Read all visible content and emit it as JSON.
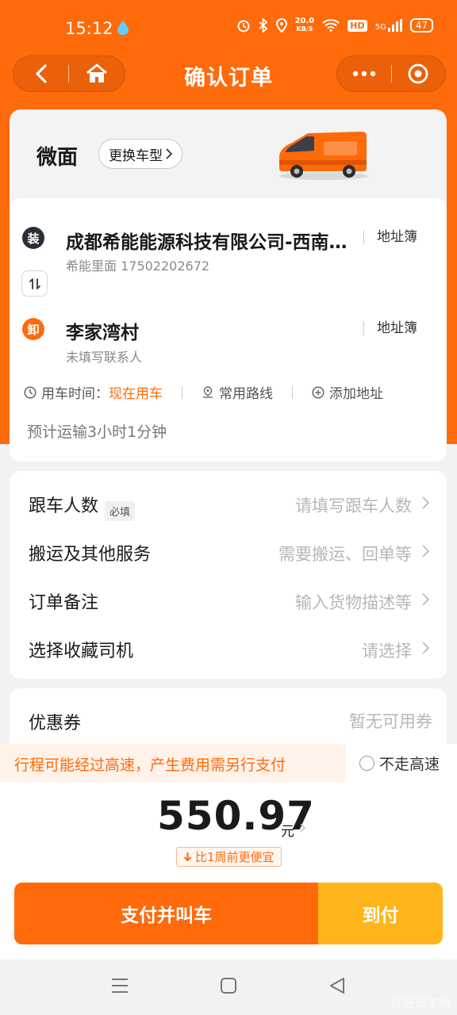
{
  "status_bar": {
    "time": "15:12",
    "speed_value": "20.0",
    "speed_unit": "KB/S",
    "hd": "HD",
    "signal": "5G",
    "battery": "47"
  },
  "nav": {
    "title": "确认订单"
  },
  "vehicle": {
    "name": "微面",
    "change_label": "更换车型"
  },
  "addresses": {
    "load_badge": "装",
    "unload_badge": "卸",
    "load_title": "成都希能能源科技有限公司-西南…",
    "load_contact": "希能里面 17502202672",
    "unload_title": "李家湾村",
    "unload_contact": "未填写联系人",
    "address_book_label": "地址簿",
    "time_prefix": "用车时间：",
    "time_value": "现在用车",
    "common_route": "常用路线",
    "add_address": "添加地址",
    "eta": "预计运输3小时1分钟"
  },
  "options": [
    {
      "label": "跟车人数",
      "value": "请填写跟车人数",
      "tag": "必填"
    },
    {
      "label": "搬运及其他服务",
      "value": "需要搬运、回单等"
    },
    {
      "label": "订单备注",
      "value": "输入货物描述等"
    },
    {
      "label": "选择收藏司机",
      "value": "请选择"
    }
  ],
  "coupon": {
    "label": "优惠券",
    "value": "暂无可用券"
  },
  "highway": {
    "notice": "行程可能经过高速，产生费用需另行支付",
    "option": "不走高速"
  },
  "price": {
    "amount": "550.97",
    "unit": "元",
    "compare": "比1周前更便宜"
  },
  "actions": {
    "pay": "支付并叫车",
    "cod": "到付"
  },
  "watermark": "旺旺玩车网",
  "colors": {
    "brand": "#ff6a0a",
    "cod": "#ffb51a"
  }
}
